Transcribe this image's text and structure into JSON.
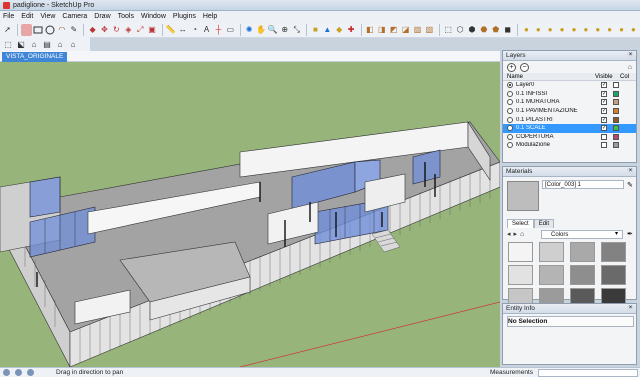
{
  "window": {
    "title": "padiglione - SketchUp Pro"
  },
  "menu": [
    "File",
    "Edit",
    "View",
    "Camera",
    "Draw",
    "Tools",
    "Window",
    "Plugins",
    "Help"
  ],
  "scene_tabs": [
    "VISTA_ORIGINALE"
  ],
  "layers_panel": {
    "title": "Layers",
    "add_symbol": "+",
    "remove_symbol": "−",
    "col_name": "Name",
    "col_visible": "Visible",
    "col_color": "Col",
    "rows": [
      {
        "name": "Layer0",
        "active": true,
        "visible": true,
        "color": "#ffffff"
      },
      {
        "name": "0.1 INFISSI",
        "active": false,
        "visible": true,
        "color": "#1aa36b"
      },
      {
        "name": "0.1 MURATURA",
        "active": false,
        "visible": true,
        "color": "#c8a080"
      },
      {
        "name": "0.1 PAVIMENTAZIONE",
        "active": false,
        "visible": true,
        "color": "#d4802a"
      },
      {
        "name": "0.1 PILASTRI",
        "active": false,
        "visible": true,
        "color": "#8b5a2b"
      },
      {
        "name": "0.1 SCALE",
        "active": false,
        "visible": true,
        "color": "#3fbf3f",
        "selected": true
      },
      {
        "name": "COPERTURA",
        "active": false,
        "visible": false,
        "color": "#b04a6a"
      },
      {
        "name": "Modulazione",
        "active": false,
        "visible": false,
        "color": "#9a9a9a"
      }
    ]
  },
  "materials_panel": {
    "title": "Materials",
    "material_name": "[Color_003] 1",
    "tab_select": "Select",
    "tab_edit": "Edit",
    "library": "Colors",
    "swatches": [
      "#f4f4f4",
      "#cfcfcf",
      "#a9a9a9",
      "#828282",
      "#e2e2e2",
      "#b4b4b4",
      "#8e8e8e",
      "#6a6a6a",
      "#c6c6c6",
      "#9b9b9b",
      "#5a5a5a",
      "#3a3a3a"
    ]
  },
  "entity_panel": {
    "title": "Entity Info",
    "selection": "No Selection"
  },
  "status": {
    "hint": "Drag in direction to pan",
    "measurements_label": "Measurements"
  },
  "colors": {
    "viewport_bg": "#97b57b",
    "scene_tab": "#3f86d6",
    "selection": "#3399ff",
    "glass": "#6f8fd8"
  }
}
